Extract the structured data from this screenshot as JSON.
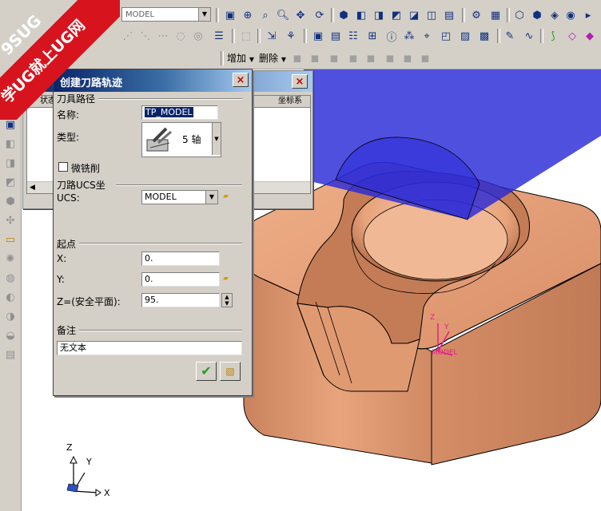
{
  "toolbar": {
    "model_combo": "MODEL",
    "add_menu": "增加",
    "delete_menu": "删除"
  },
  "watermark": {
    "line1": "9SUG",
    "line2": "学UG就上UG网"
  },
  "back_dialog": {
    "col_status": "状态",
    "col_coord": "坐标系"
  },
  "dialog": {
    "title": "创建刀路轨迹",
    "close_label": "×",
    "group_toolpath": "刀具路径",
    "name_label": "名称:",
    "name_value": "TP_MODEL",
    "type_label": "类型:",
    "type_value": "5 轴",
    "micro_milling": "微铣削",
    "group_ucs": "刀路UCS坐",
    "ucs_label": "UCS:",
    "ucs_value": "MODEL",
    "group_start": "起点",
    "x_label": "X:",
    "x_value": "0.",
    "y_label": "Y:",
    "y_value": "0.",
    "z_label": "Z=(安全平面):",
    "z_value": "95.",
    "group_notes": "备注",
    "notes_value": "无文本",
    "ok_label": "✔"
  },
  "viewport": {
    "model_axis_z": "Z",
    "model_axis_y": "Y",
    "model_label": "MODEL",
    "world_axis_z": "Z",
    "world_axis_y": "Y",
    "world_axis_x": "X"
  },
  "colors": {
    "part": "#e39a72",
    "plane": "#2a2ad8",
    "title_start": "#0a246a",
    "title_end": "#a6caf0",
    "marker": "#e0208c"
  }
}
